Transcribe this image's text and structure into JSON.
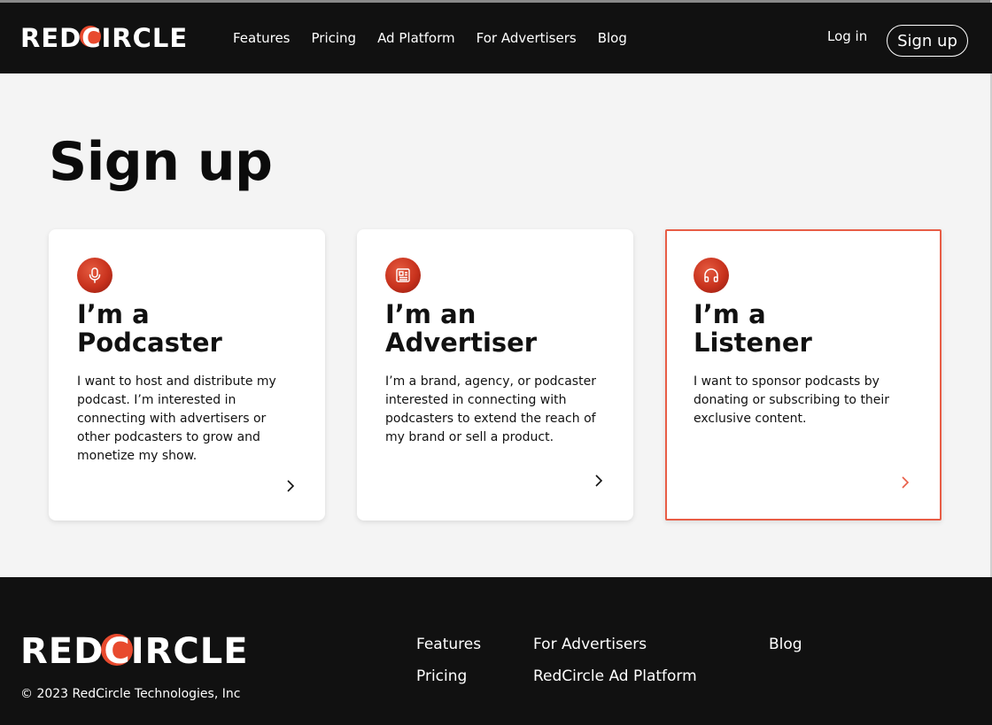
{
  "colors": {
    "accent": "#e84a2e",
    "dark": "#111111",
    "page_bg": "#f4f4f4"
  },
  "header": {
    "logo_left": "RED",
    "logo_o": "C",
    "logo_right": "IRCLE",
    "nav": [
      "Features",
      "Pricing",
      "Ad Platform",
      "For Advertisers",
      "Blog"
    ],
    "login": "Log in",
    "signup": "Sign up"
  },
  "main": {
    "title": "Sign up",
    "cards": [
      {
        "icon": "microphone-icon",
        "title": "I’m a\nPodcaster",
        "desc": "I want to host and distribute my podcast. I’m interested in connecting with advertisers or other podcasters to grow and monetize my show.",
        "chevron": "chevron-right-icon"
      },
      {
        "icon": "newspaper-icon",
        "title": "I’m an\nAdvertiser",
        "desc": "I’m a brand, agency, or podcaster interested in connecting with podcasters to extend the reach of my brand or sell a product.",
        "chevron": "chevron-right-icon"
      },
      {
        "icon": "headphones-icon",
        "title": "I’m a\nListener",
        "desc": "I want to sponsor podcasts by donating or subscribing to their exclusive content.",
        "chevron": "chevron-right-icon",
        "selected": true
      }
    ]
  },
  "footer": {
    "copyright": "© 2023 RedCircle Technologies, Inc",
    "links": {
      "features": "Features",
      "pricing": "Pricing",
      "for_advertisers": "For Advertisers",
      "ad_platform": "RedCircle Ad Platform",
      "blog": "Blog"
    }
  }
}
